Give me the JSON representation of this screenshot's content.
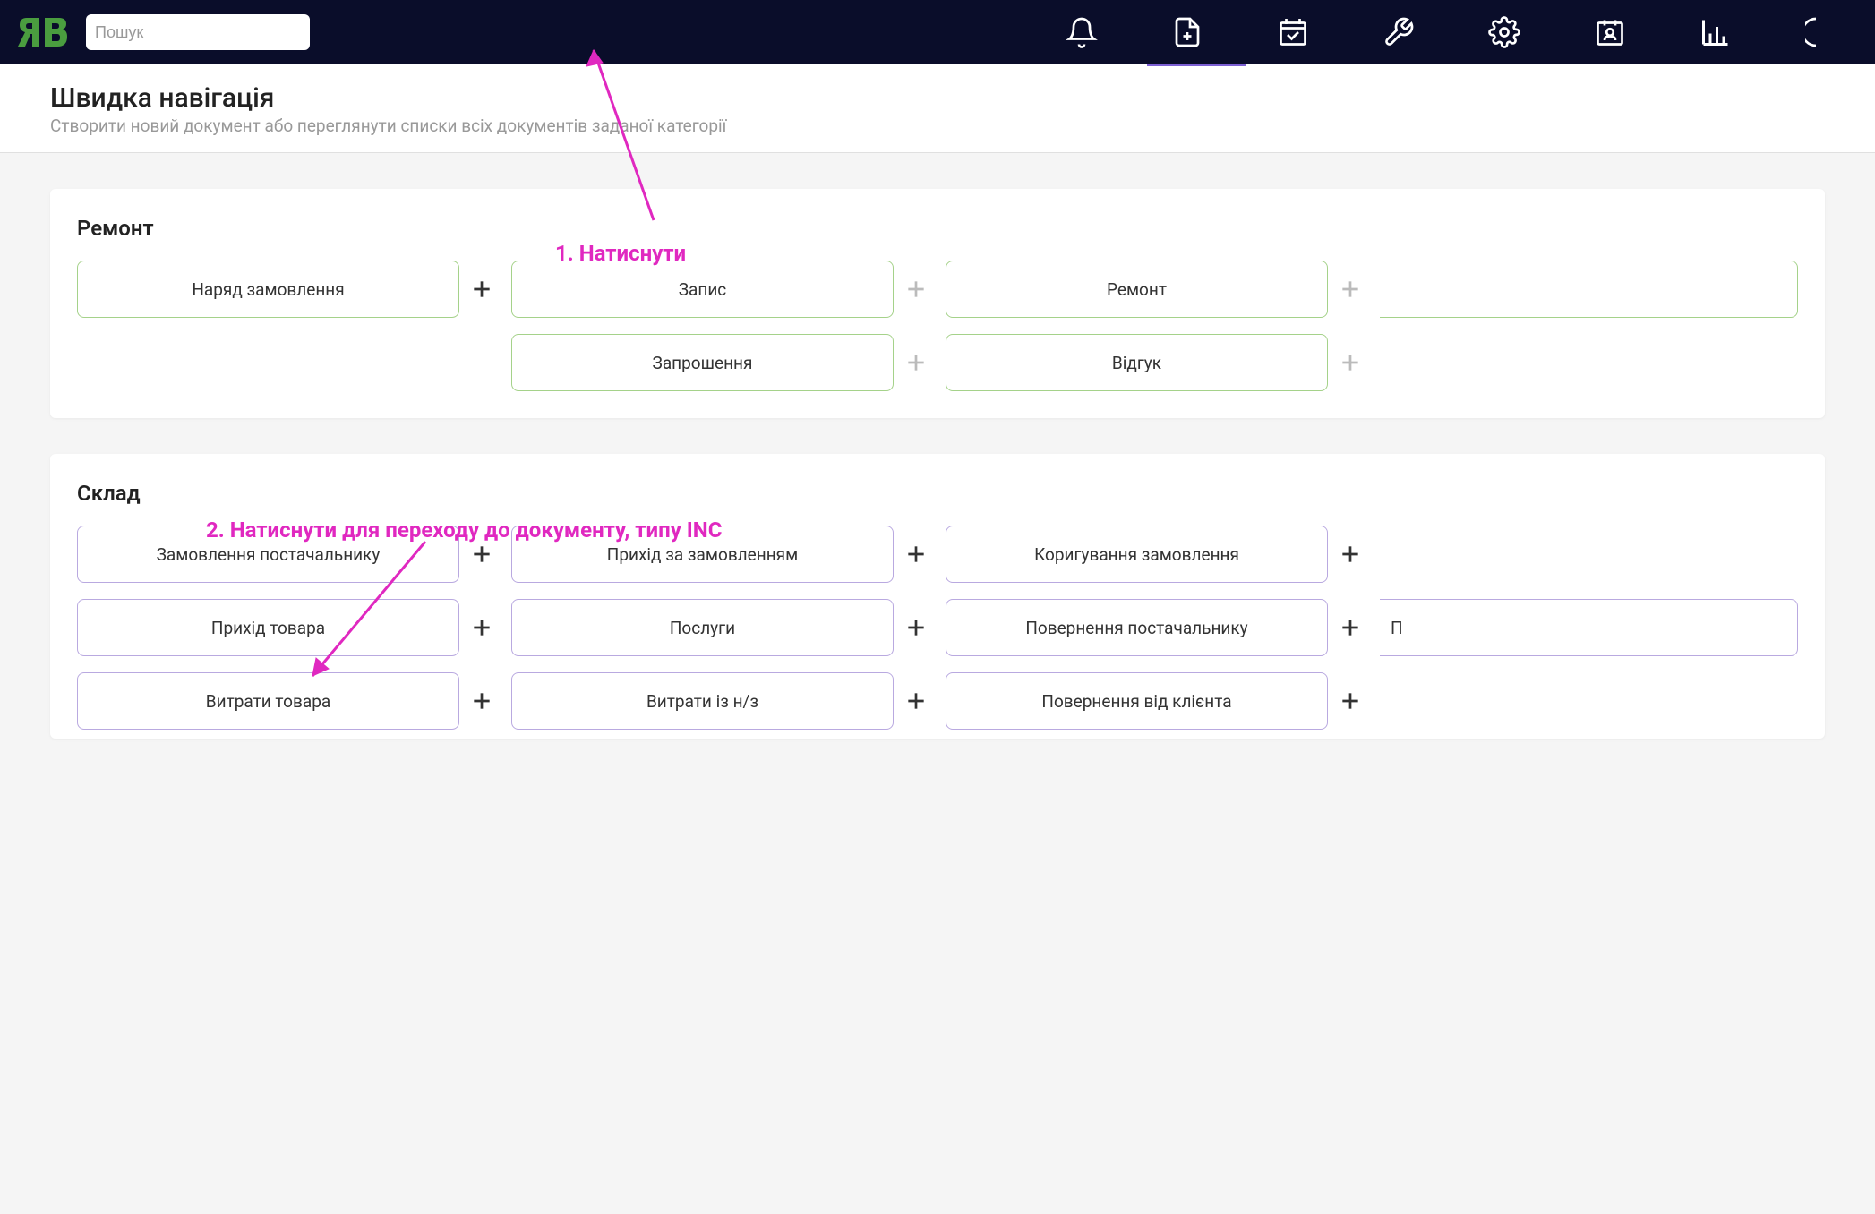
{
  "search": {
    "placeholder": "Пошук"
  },
  "page": {
    "title": "Швидка навігація",
    "subtitle": "Створити новий документ або переглянути списки всіх документів заданої категорії"
  },
  "sections": {
    "repair": {
      "title": "Ремонт",
      "rows": [
        [
          {
            "label": "Наряд замовлення",
            "plus": "dark",
            "partial": false
          },
          {
            "label": "Запис",
            "plus": "light",
            "partial": false
          },
          {
            "label": "Ремонт",
            "plus": "light",
            "partial": false
          },
          {
            "label": "",
            "plus": null,
            "partial": true
          }
        ],
        [
          null,
          {
            "label": "Запрошення",
            "plus": "light",
            "partial": false
          },
          {
            "label": "Відгук",
            "plus": "light",
            "partial": false
          },
          null
        ]
      ],
      "color": "green"
    },
    "warehouse": {
      "title": "Склад",
      "rows": [
        [
          {
            "label": "Замовлення постачальнику",
            "plus": "dark",
            "partial": false
          },
          {
            "label": "Прихід за замовленням",
            "plus": "dark",
            "partial": false
          },
          {
            "label": "Коригування замовлення",
            "plus": "dark",
            "partial": false
          },
          null
        ],
        [
          {
            "label": "Прихід товара",
            "plus": "dark",
            "partial": false
          },
          {
            "label": "Послуги",
            "plus": "dark",
            "partial": false
          },
          {
            "label": "Повернення постачальнику",
            "plus": "dark",
            "partial": false
          },
          {
            "label": "П",
            "plus": null,
            "partial": true
          }
        ],
        [
          {
            "label": "Витрати товара",
            "plus": "dark",
            "partial": false
          },
          {
            "label": "Витрати із н/з",
            "plus": "dark",
            "partial": false
          },
          {
            "label": "Повернення від клієнта",
            "plus": "dark",
            "partial": false
          },
          null
        ]
      ],
      "color": "purple"
    }
  },
  "annotations": {
    "step1": "1. Натиснути",
    "step2": "2. Натиснути для переходу до документу, типу INC"
  }
}
